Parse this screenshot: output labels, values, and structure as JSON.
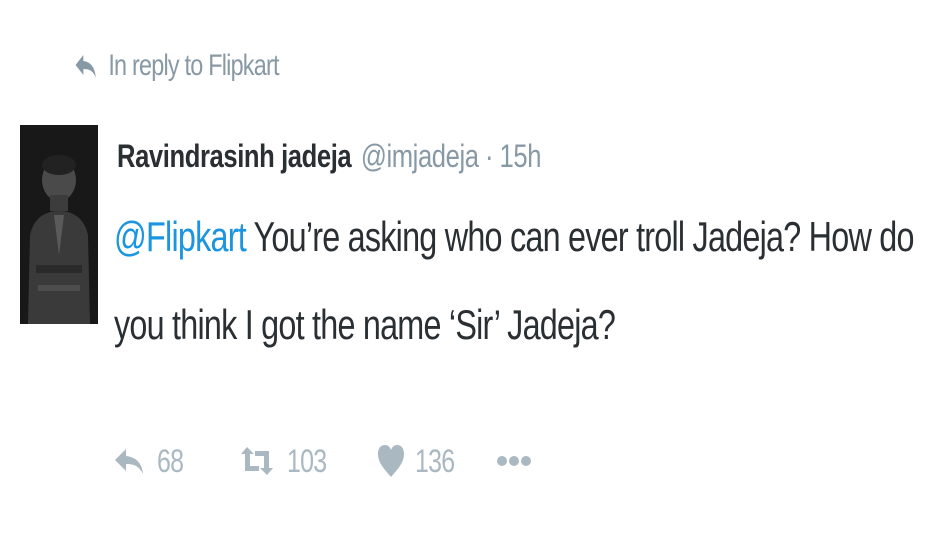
{
  "reply_context": {
    "icon": "reply-arrow-icon",
    "text": "In reply to Flipkart"
  },
  "tweet": {
    "author": {
      "name": "Ravindrasinh jadeja",
      "handle": "@imjadeja",
      "separator": "·",
      "time": "15h",
      "avatar": "profile-photo"
    },
    "body": {
      "mention": "@Flipkart",
      "text": " You’re asking who can ever troll Jadeja? How do you think I got the name ‘Sir’ Jadeja?"
    },
    "actions": {
      "reply": {
        "icon": "reply-icon",
        "count": "68"
      },
      "retweet": {
        "icon": "retweet-icon",
        "count": "103"
      },
      "like": {
        "icon": "heart-icon",
        "count": "136"
      },
      "more": {
        "icon": "more-dots-icon"
      }
    }
  },
  "colors": {
    "text": "#292f33",
    "muted": "#8899a6",
    "action": "#aab8c2",
    "link": "#1b95e0"
  }
}
